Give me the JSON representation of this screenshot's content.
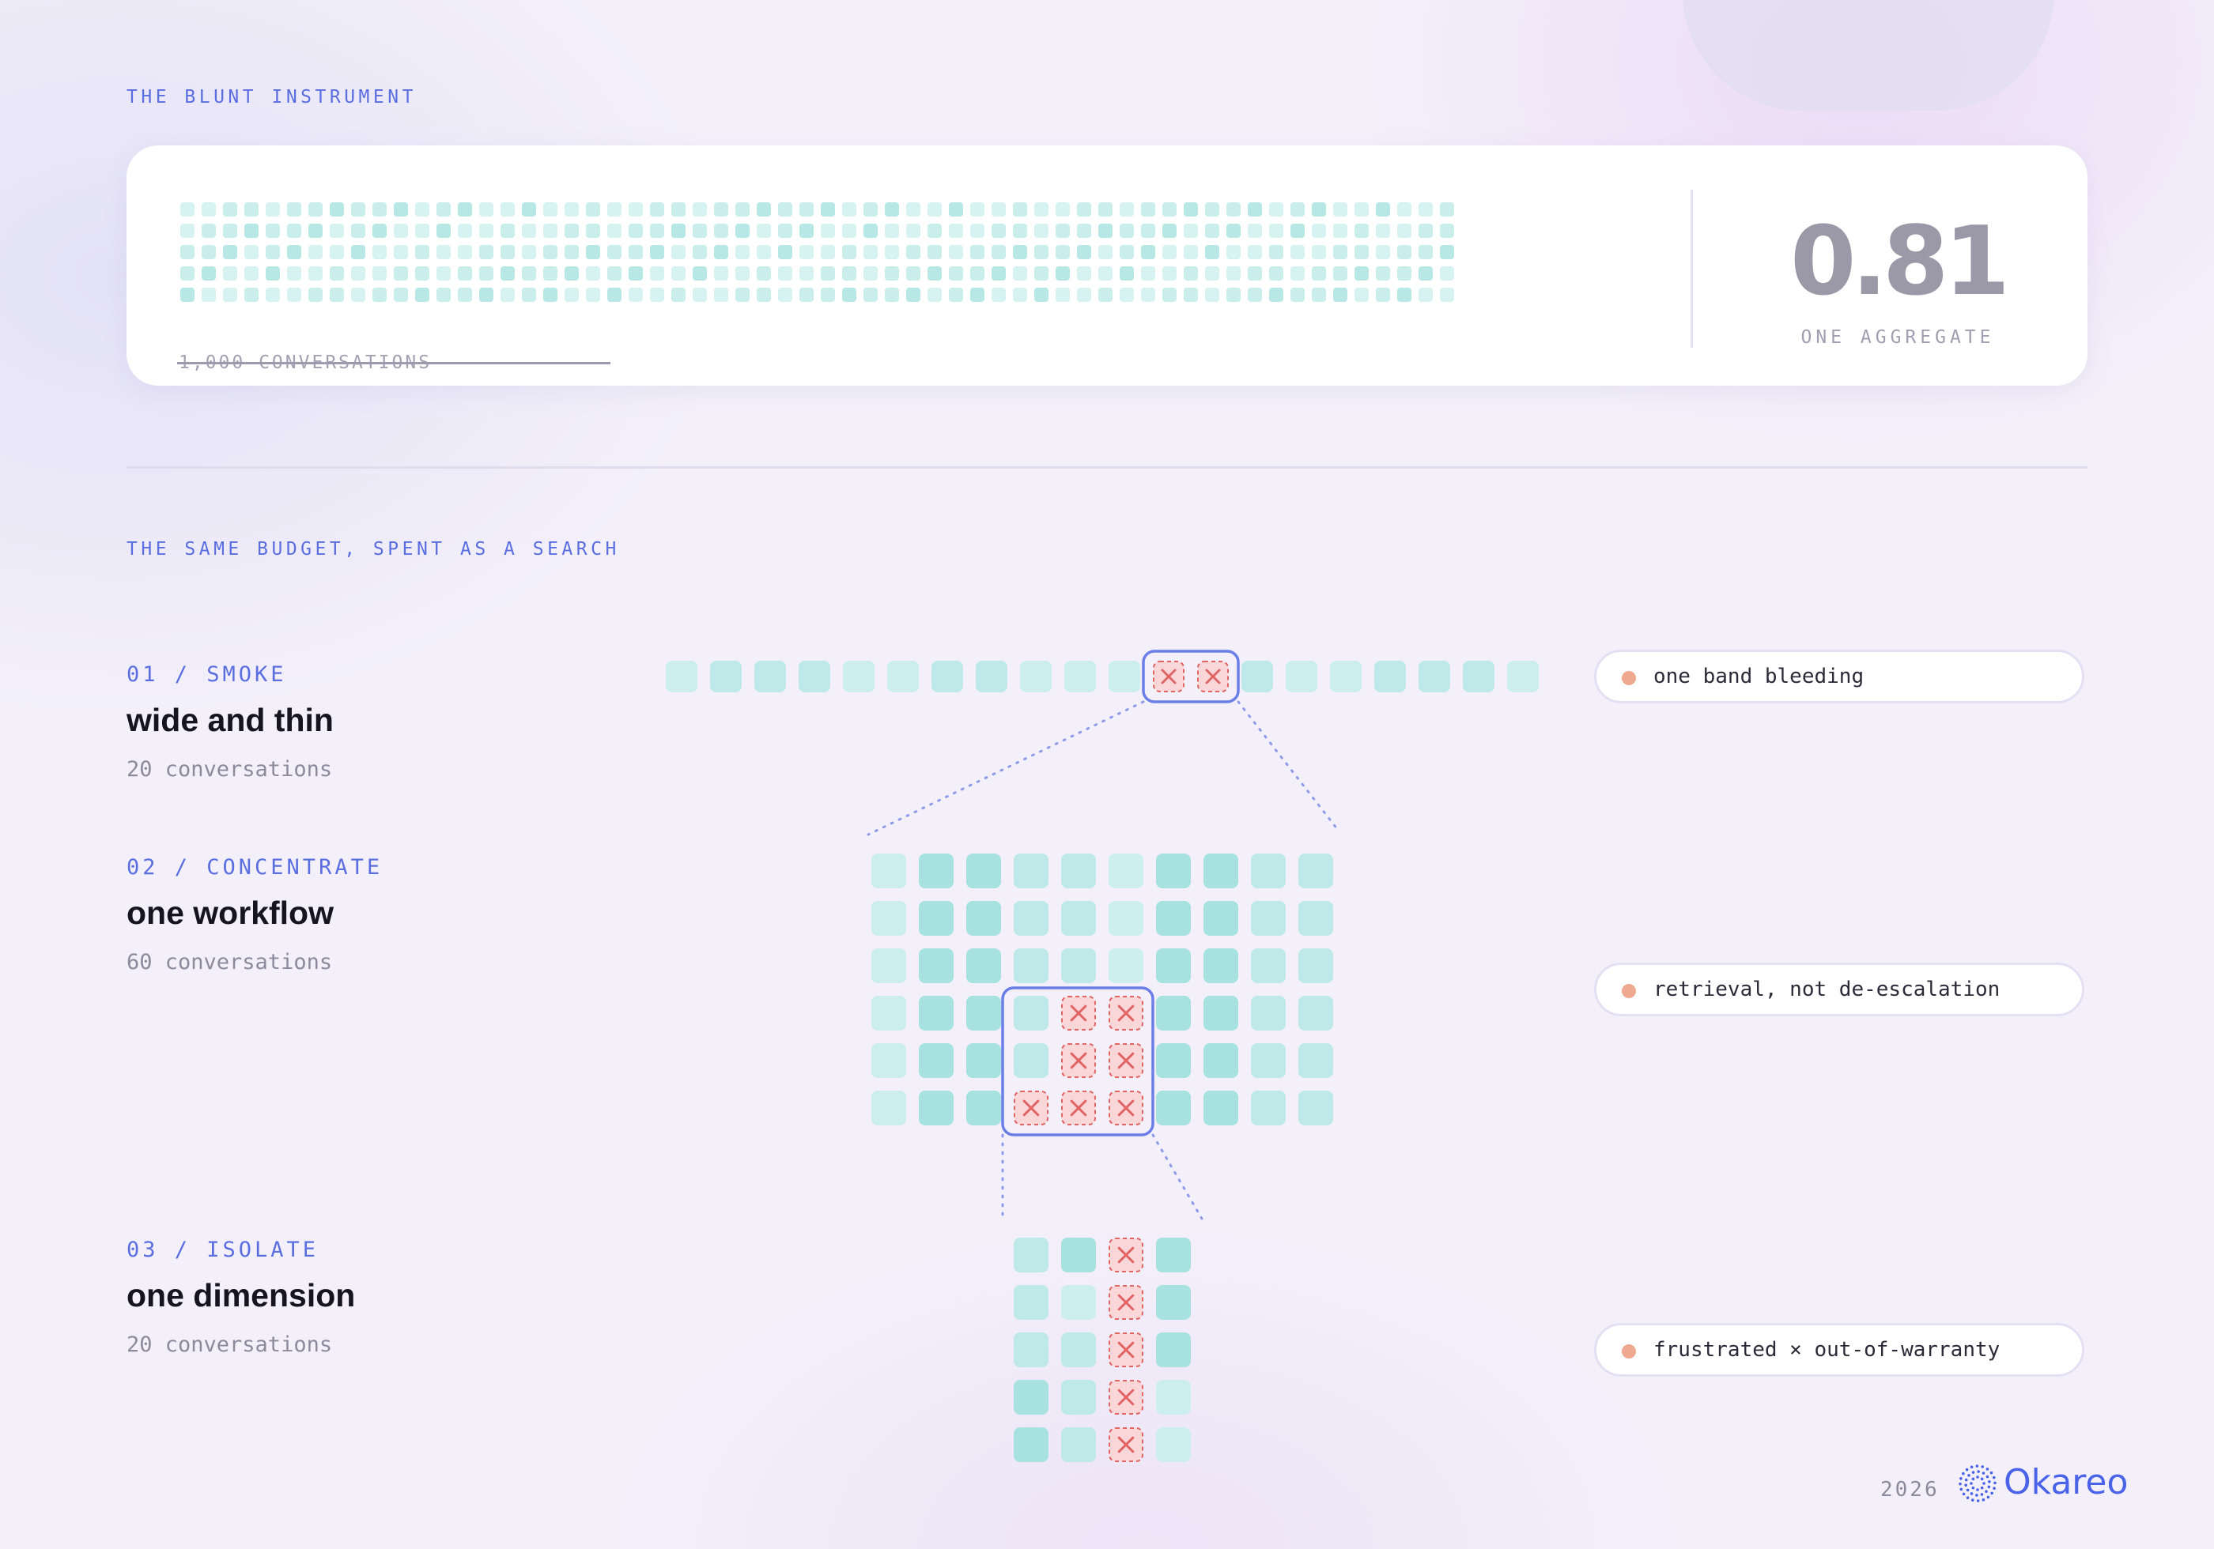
{
  "header": {
    "eyebrow": "THE BLUNT INSTRUMENT"
  },
  "aggregate_card": {
    "conversations_label": "1,000 CONVERSATIONS",
    "value": "0.81",
    "value_label": "ONE AGGREGATE"
  },
  "search_section": {
    "eyebrow": "THE SAME BUDGET, SPENT AS A SEARCH"
  },
  "steps": [
    {
      "tag": "01 / SMOKE",
      "title": "wide and thin",
      "count": "20 conversations",
      "finding": "one band bleeding"
    },
    {
      "tag": "02 / CONCENTRATE",
      "title": "one workflow",
      "count": "60 conversations",
      "finding": "retrieval, not de-escalation"
    },
    {
      "tag": "03 / ISOLATE",
      "title": "one dimension",
      "count": "20 conversations",
      "finding": "frustrated × out-of-warranty"
    }
  ],
  "grids": {
    "smoke": {
      "rows": 1,
      "cols": 20,
      "failures": [
        [
          0,
          11
        ],
        [
          0,
          12
        ]
      ]
    },
    "concentrate": {
      "rows": 6,
      "cols": 10,
      "failures": [
        [
          3,
          4
        ],
        [
          3,
          5
        ],
        [
          4,
          4
        ],
        [
          4,
          5
        ],
        [
          5,
          3
        ],
        [
          5,
          4
        ],
        [
          5,
          5
        ]
      ]
    },
    "isolate": {
      "rows": 5,
      "cols": 4,
      "failures": [
        [
          0,
          2
        ],
        [
          1,
          2
        ],
        [
          2,
          2
        ],
        [
          3,
          2
        ],
        [
          4,
          2
        ]
      ]
    }
  },
  "colors": {
    "accent": "#5a6ee0",
    "cell_light": "#cdeeee",
    "cell_mid": "#bfe8e8",
    "cell_dark": "#a8e2e0",
    "failure_fill": "#f9d6d8",
    "failure_mark": "#e06464",
    "bracket": "#6b7ee8",
    "finding_dot": "#eea990"
  },
  "footer": {
    "year": "2026",
    "brand": "Okareo"
  }
}
